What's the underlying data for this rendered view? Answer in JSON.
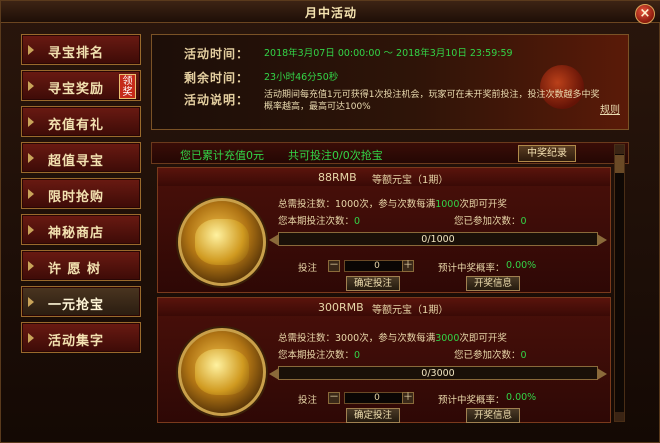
{
  "window": {
    "title": "月中活动",
    "close_symbol": "×"
  },
  "sidebar": {
    "items": [
      {
        "label": "寻宝排名"
      },
      {
        "label": "寻宝奖励",
        "badge": "领奖"
      },
      {
        "label": "充值有礼"
      },
      {
        "label": "超值寻宝"
      },
      {
        "label": "限时抢购"
      },
      {
        "label": "神秘商店"
      },
      {
        "label": "许 愿 树"
      },
      {
        "label": "一元抢宝",
        "active": true
      },
      {
        "label": "活动集字"
      }
    ]
  },
  "info": {
    "time_label": "活动时间：",
    "time_value": "2018年3月07日 00:00:00 ～ 2018年3月10日 23:59:59",
    "remain_label": "剩余时间：",
    "remain_value": "23小时46分50秒",
    "desc_label": "活动说明：",
    "desc_value": "活动期间每充值1元可获得1次投注机会，玩家可在未开奖前投注，投注次数越多中奖概率越高，最高可达100%",
    "rule_link": "规则"
  },
  "summary": {
    "recharged": "您已累计充值0元",
    "bets": "共可投注0/0次抢宝",
    "history_button": "中奖纪录"
  },
  "items": [
    {
      "price": "88RMB",
      "name": "等额元宝（1期）",
      "total_label": "总需投注数：",
      "total": "1000次，参与次数每满",
      "total_green": "1000",
      "total_suffix": "次即可开奖",
      "my_bets_label": "您本期投注次数：",
      "my_bets": "0",
      "joined_label": "您已参加次数：",
      "joined": "0",
      "progress": "0/1000",
      "progress_fraction": 0,
      "bet_label": "投注",
      "bet_value": "0",
      "minus": "－",
      "plus": "＋",
      "confirm_button": "确定投注",
      "prob_label": "预计中奖概率：",
      "prob_value": "0.00%",
      "open_button": "开奖信息"
    },
    {
      "price": "300RMB",
      "name": "等额元宝（1期）",
      "total_label": "总需投注数：",
      "total": "3000次，参与次数每满",
      "total_green": "3000",
      "total_suffix": "次即可开奖",
      "my_bets_label": "您本期投注次数：",
      "my_bets": "0",
      "joined_label": "您已参加次数：",
      "joined": "0",
      "progress": "0/3000",
      "progress_fraction": 0,
      "bet_label": "投注",
      "bet_value": "0",
      "minus": "－",
      "plus": "＋",
      "confirm_button": "确定投注",
      "prob_label": "预计中奖概率：",
      "prob_value": "0.00%",
      "open_button": "开奖信息"
    }
  ],
  "colors": {
    "accent_green": "#33d447",
    "frame_gold": "#9a6a2c",
    "panel_red": "#4a100a"
  }
}
